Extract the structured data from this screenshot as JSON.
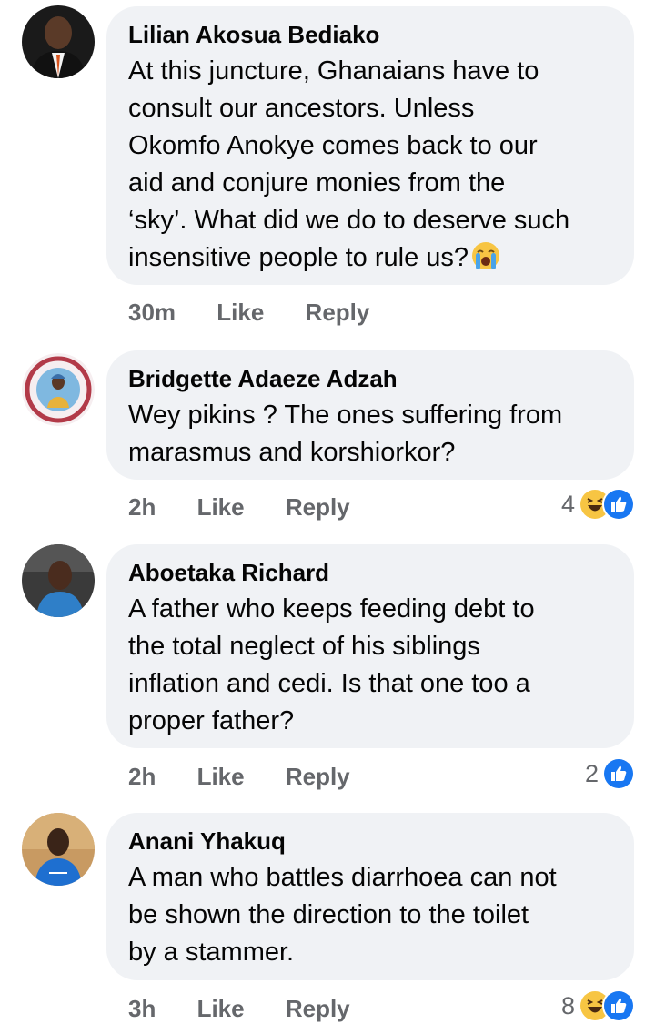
{
  "comments": [
    {
      "author": "Lilian Akosua Bediako",
      "text": "At this juncture, Ghanaians have to\nconsult our ancestors. Unless\nOkomfo Anokye  comes back to our\naid and conjure monies from the\n‘sky’. What did we do to deserve such\ninsensitive people to rule us?",
      "inline_emoji": "crying-face-emoji",
      "time": "30m",
      "like_label": "Like",
      "reply_label": "Reply",
      "reaction_count": "",
      "reactions": []
    },
    {
      "author": "Bridgette Adaeze Adzah",
      "text": "Wey pikins ? The ones suffering from\nmarasmus and korshiorkor?",
      "time": "2h",
      "like_label": "Like",
      "reply_label": "Reply",
      "reaction_count": "4",
      "reactions": [
        "haha-icon",
        "like-icon"
      ]
    },
    {
      "author": "Aboetaka Richard",
      "text": "A father who keeps feeding debt to\nthe total neglect of his siblings\ninflation and cedi. Is that one too a\nproper father?",
      "time": "2h",
      "like_label": "Like",
      "reply_label": "Reply",
      "reaction_count": "2",
      "reactions": [
        "like-icon"
      ]
    },
    {
      "author": "Anani Yhakuq",
      "text": "A man who battles diarrhoea can not\nbe shown the direction to the toilet\nby a stammer.",
      "time": "3h",
      "like_label": "Like",
      "reply_label": "Reply",
      "reaction_count": "8",
      "reactions": [
        "haha-icon",
        "like-icon"
      ]
    }
  ],
  "colors": {
    "bubble": "#f0f2f5",
    "meta_text": "#65676b",
    "like_blue": "#1877f2",
    "haha_yellow": "#f7c543"
  }
}
